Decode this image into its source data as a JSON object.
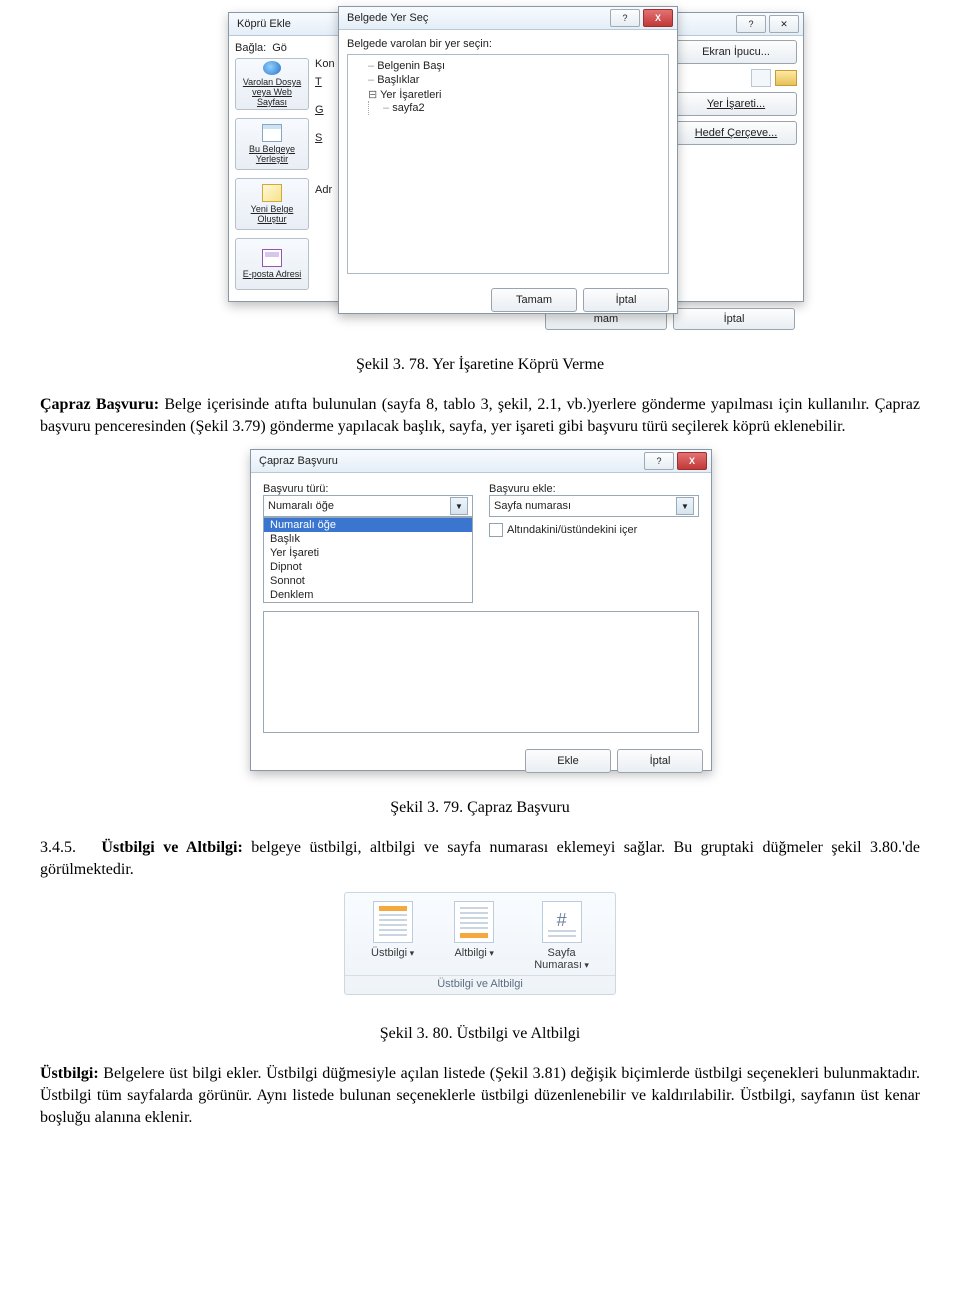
{
  "hyperlink_dialog": {
    "title": "Köprü Ekle",
    "link_to_label": "Bağla:",
    "display_label": "Gö",
    "lookin_label": "Kon",
    "opt_existing": "Varolan Dosya veya Web Sayfası",
    "opt_place": "Bu Belgeye Yerleştir",
    "opt_newdoc": "Yeni Belge Oluştur",
    "opt_email": "E-posta Adresi",
    "col_t": "T",
    "col_g": "G",
    "col_s": "S",
    "addr_label": "Adr"
  },
  "place_dialog": {
    "title": "Belgede Yer Seç",
    "prompt": "Belgede varolan bir yer seçin:",
    "item_top": "Belgenin Başı",
    "item_headings": "Başlıklar",
    "item_bookmarks": "Yer İşaretleri",
    "item_sayfa2": "sayfa2",
    "ok": "Tamam",
    "cancel": "İptal",
    "help": "?",
    "close": "X"
  },
  "back_dialog": {
    "help": "?",
    "close_sym": "✕",
    "btn_screentip": "Ekran İpucu...",
    "btn_bookmark": "Yer İşareti...",
    "btn_targetframe": "Hedef Çerçeve...",
    "btn_ok_trunc": "mam",
    "btn_cancel": "İptal"
  },
  "caption1": "Şekil 3. 78. Yer İşaretine Köprü Verme",
  "para1_strong": "Çapraz Başvuru:",
  "para1_rest": " Belge içerisinde atıfta bulunulan (sayfa 8, tablo 3, şekil, 2.1, vb.)yerlere gönderme yapılması için kullanılır. Çapraz başvuru penceresinden (Şekil 3.79) gönderme yapılacak başlık, sayfa, yer işareti gibi başvuru türü seçilerek köprü eklenebilir.",
  "crossref_dialog": {
    "title": "Çapraz Başvuru",
    "ref_type_label": "Başvuru türü:",
    "insert_ref_label": "Başvuru ekle:",
    "combo_ref_type": "Numaralı öğe",
    "combo_insert": "Sayfa numarası",
    "chk_include": "Altındakini/üstündekini içer",
    "list_items": [
      "Numaralı öğe",
      "Başlık",
      "Yer İşareti",
      "Dipnot",
      "Sonnot",
      "Denklem"
    ],
    "btn_insert": "Ekle",
    "btn_cancel": "İptal",
    "help": "?",
    "close": "X"
  },
  "caption2": "Şekil 3. 79. Çapraz Başvuru",
  "sect_num": "3.4.5.",
  "sect_strong": "Üstbilgi ve Altbilgi:",
  "sect_rest": " belgeye üstbilgi, altbilgi ve sayfa numarası eklemeyi sağlar. Bu gruptaki düğmeler şekil 3.80.'de görülmektedir.",
  "ribbon": {
    "header": "Üstbilgi",
    "footer": "Altbilgi",
    "pagenum_l1": "Sayfa",
    "pagenum_l2": "Numarası",
    "group": "Üstbilgi ve Altbilgi"
  },
  "caption3": "Şekil 3. 80. Üstbilgi ve Altbilgi",
  "para2_strong": "Üstbilgi:",
  "para2_rest": " Belgelere üst bilgi ekler. Üstbilgi düğmesiyle açılan listede (Şekil 3.81) değişik biçimlerde üstbilgi seçenekleri bulunmaktadır. Üstbilgi tüm sayfalarda görünür. Aynı listede bulunan seçeneklerle üstbilgi düzenlenebilir ve kaldırılabilir. Üstbilgi, sayfanın üst kenar boşluğu alanına eklenir."
}
